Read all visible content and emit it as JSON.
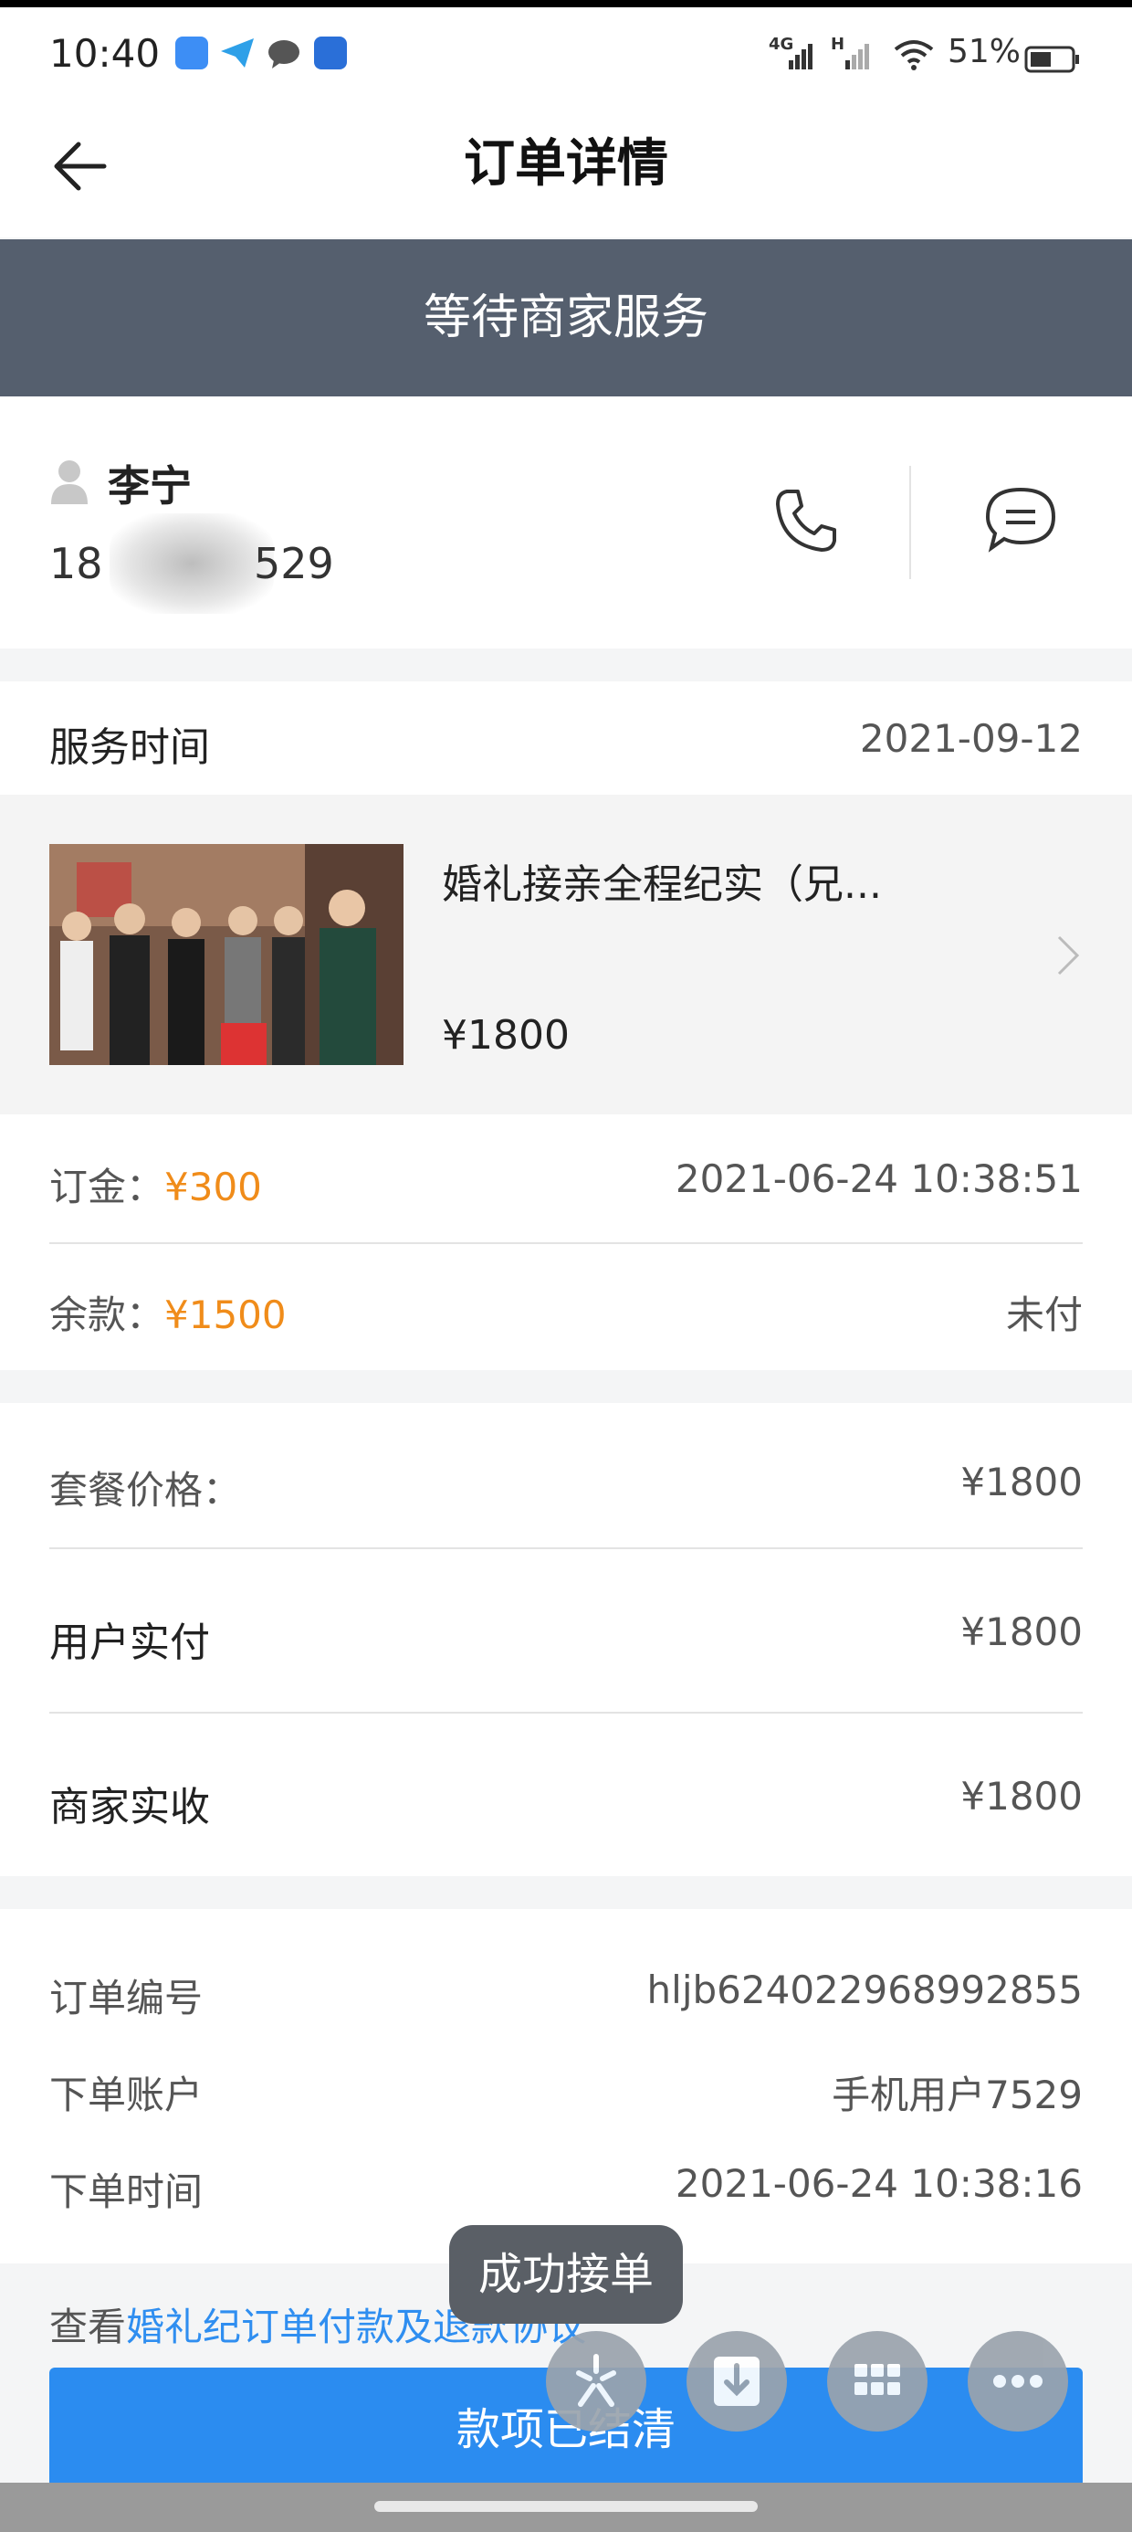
{
  "status_bar": {
    "time": "10:40",
    "network_4g": "4G",
    "network_h": "H",
    "battery": "51%"
  },
  "header": {
    "title": "订单详情",
    "back_icon": "arrow-left-icon"
  },
  "banner": {
    "status": "等待商家服务"
  },
  "customer": {
    "name": "李宁",
    "phone_prefix": "18",
    "phone_suffix": "529"
  },
  "service": {
    "time_label": "服务时间",
    "time_value": "2021-09-12",
    "product_title": "婚礼接亲全程纪实（兄...",
    "product_price": "¥1800"
  },
  "payment": {
    "deposit_label": "订金：",
    "deposit_amount": "¥300",
    "deposit_time": "2021-06-24 10:38:51",
    "balance_label": "余款：",
    "balance_amount": "¥1500",
    "balance_status": "未付"
  },
  "prices": {
    "package_label": "套餐价格：",
    "package_value": "¥1800",
    "user_paid_label": "用户实付",
    "user_paid_value": "¥1800",
    "merchant_label": "商家实收",
    "merchant_value": "¥1800"
  },
  "order_info": {
    "number_label": "订单编号",
    "number_value": "hljb624022968992855",
    "account_label": "下单账户",
    "account_value": "手机用户7529",
    "time_label": "下单时间",
    "time_value": "2021-06-24 10:38:16"
  },
  "agreement": {
    "prefix": "查看",
    "link": "婚礼纪订单付款及退款协议"
  },
  "toast": "成功接单",
  "bottom_button": "款项已结清",
  "colors": {
    "accent_orange": "#f08c1a",
    "primary_blue": "#2b8cf0",
    "banner_bg": "#555f6e"
  }
}
